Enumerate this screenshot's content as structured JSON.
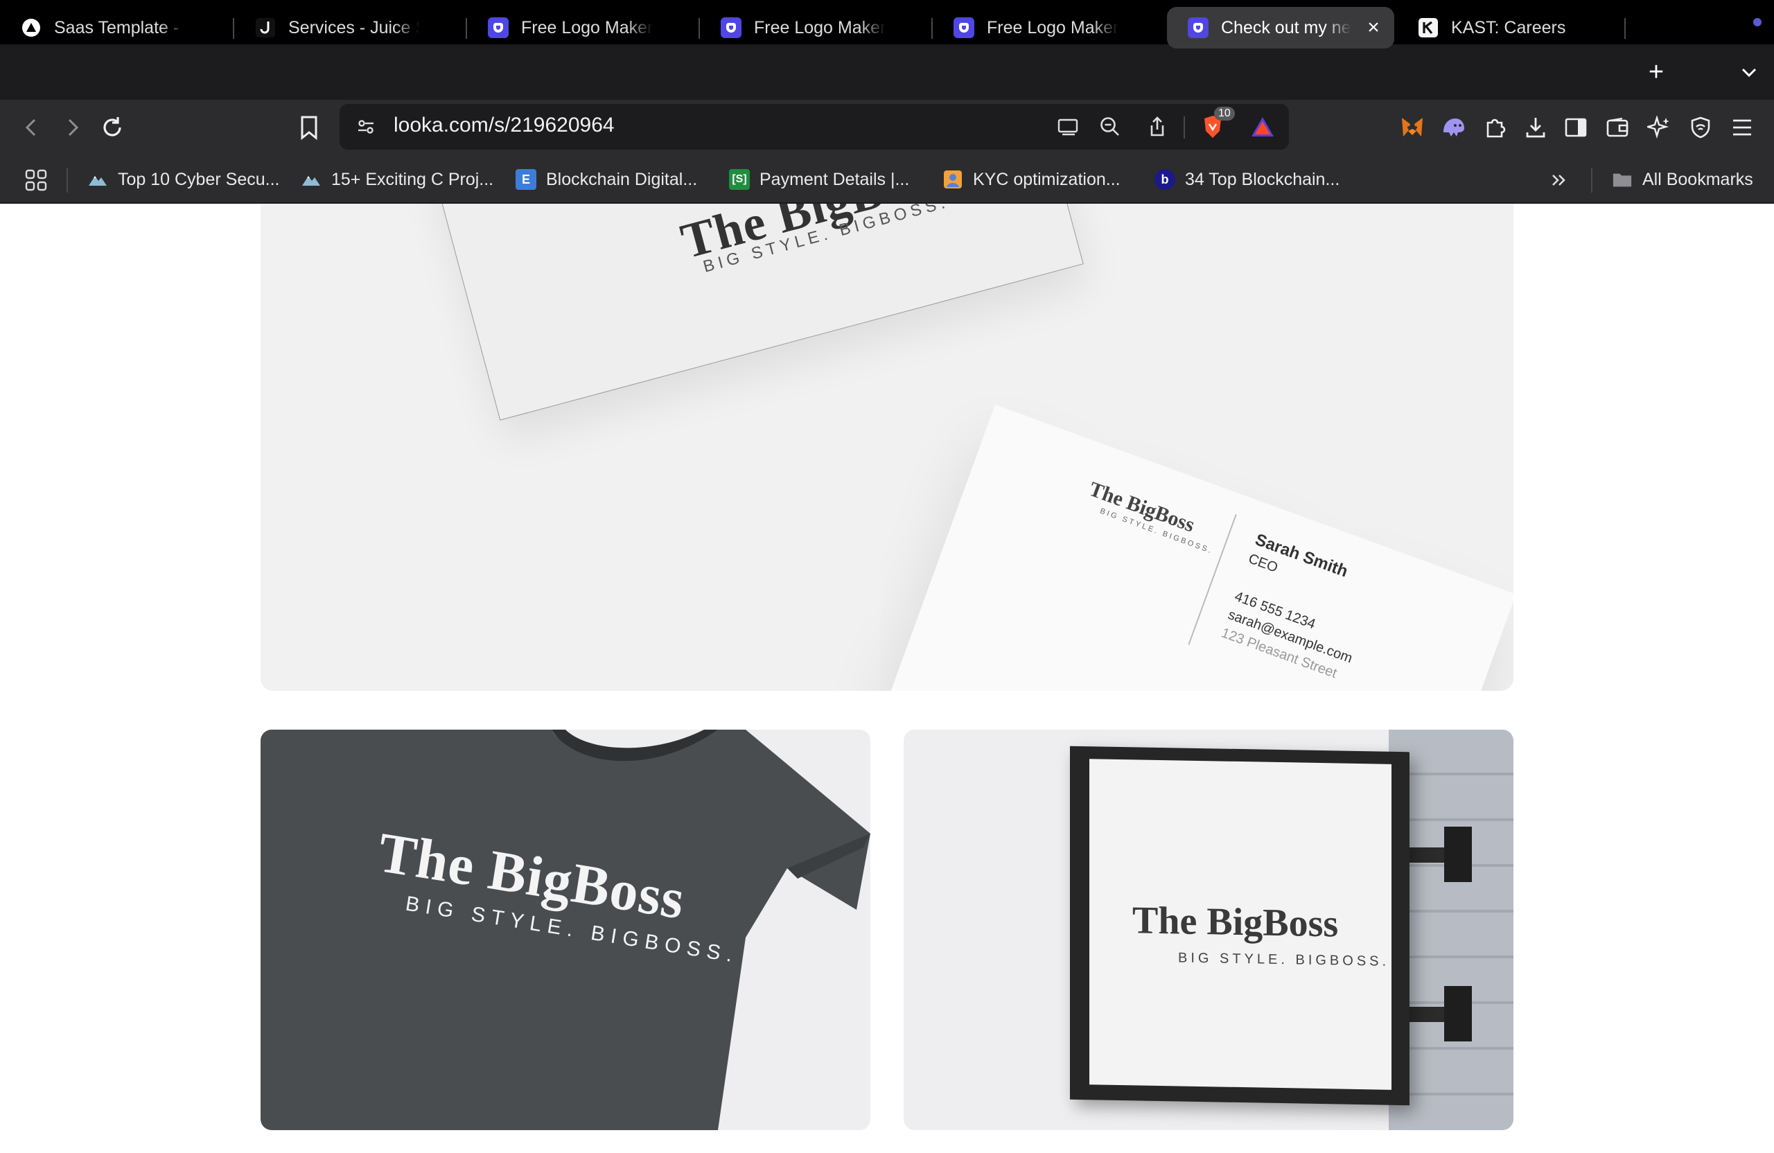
{
  "tabs": [
    {
      "title": "Saas Template - Eldo",
      "icon": "triangle-logo-icon"
    },
    {
      "title": "Services - Juice Salo",
      "icon": "juice-logo-icon"
    },
    {
      "title": "Free Logo Maker - Ge",
      "icon": "looka-logo-icon"
    },
    {
      "title": "Free Logo Maker - Ge",
      "icon": "looka-logo-icon"
    },
    {
      "title": "Free Logo Maker - Ge",
      "icon": "looka-logo-icon"
    },
    {
      "title": "Check out my ne",
      "icon": "looka-logo-icon",
      "active": true
    },
    {
      "title": "KAST: Careers",
      "icon": "kast-logo-icon"
    }
  ],
  "toolbar": {
    "url": "looka.com/s/219620964",
    "shields_count": "10"
  },
  "bookmarks": [
    {
      "label": "Top 10 Cyber Secu...",
      "icon": "mountain-icon"
    },
    {
      "label": "15+ Exciting C Proj...",
      "icon": "mountain-icon"
    },
    {
      "label": "Blockchain Digital...",
      "icon": "e-icon",
      "icon_text": "E"
    },
    {
      "label": "Payment Details |...",
      "icon": "s-icon",
      "icon_text": "[S]"
    },
    {
      "label": "KYC optimization...",
      "icon": "kyc-icon"
    },
    {
      "label": "34 Top Blockchain...",
      "icon": "b-icon",
      "icon_text": "b"
    }
  ],
  "all_bookmarks": "All Bookmarks",
  "mockups": {
    "card_brand": "The BigBoss",
    "slogan": "BIG STYLE. BIGBOSS.",
    "contact_name": "Sarah Smith",
    "contact_title": "CEO",
    "contact_phone": "416 555 1234",
    "contact_email": "sarah@example.com",
    "contact_address": "123 Pleasant Street",
    "shirt_brand": "The BigBoss",
    "shirt_slogan": "BIG STYLE. BIGBOSS.",
    "sign_brand": "The BigBoss",
    "sign_slogan": "BIG STYLE. BIGBOSS."
  },
  "colors": {
    "accent": "#4f46e5",
    "tab_bar": "#1c1c1e",
    "toolbar": "#2c2c2e",
    "shirt": "#4a4d50"
  }
}
